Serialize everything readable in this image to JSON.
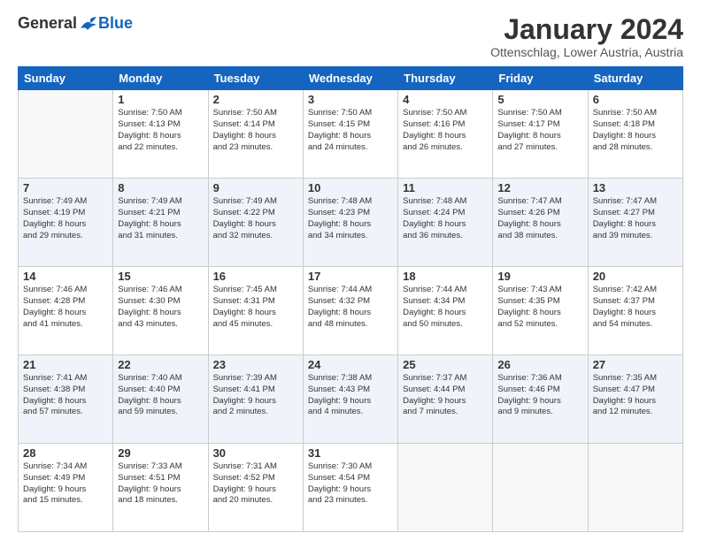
{
  "logo": {
    "general": "General",
    "blue": "Blue"
  },
  "header": {
    "title": "January 2024",
    "subtitle": "Ottenschlag, Lower Austria, Austria"
  },
  "days_of_week": [
    "Sunday",
    "Monday",
    "Tuesday",
    "Wednesday",
    "Thursday",
    "Friday",
    "Saturday"
  ],
  "weeks": [
    [
      {
        "day": "",
        "info": ""
      },
      {
        "day": "1",
        "info": "Sunrise: 7:50 AM\nSunset: 4:13 PM\nDaylight: 8 hours\nand 22 minutes."
      },
      {
        "day": "2",
        "info": "Sunrise: 7:50 AM\nSunset: 4:14 PM\nDaylight: 8 hours\nand 23 minutes."
      },
      {
        "day": "3",
        "info": "Sunrise: 7:50 AM\nSunset: 4:15 PM\nDaylight: 8 hours\nand 24 minutes."
      },
      {
        "day": "4",
        "info": "Sunrise: 7:50 AM\nSunset: 4:16 PM\nDaylight: 8 hours\nand 26 minutes."
      },
      {
        "day": "5",
        "info": "Sunrise: 7:50 AM\nSunset: 4:17 PM\nDaylight: 8 hours\nand 27 minutes."
      },
      {
        "day": "6",
        "info": "Sunrise: 7:50 AM\nSunset: 4:18 PM\nDaylight: 8 hours\nand 28 minutes."
      }
    ],
    [
      {
        "day": "7",
        "info": "Sunrise: 7:49 AM\nSunset: 4:19 PM\nDaylight: 8 hours\nand 29 minutes."
      },
      {
        "day": "8",
        "info": "Sunrise: 7:49 AM\nSunset: 4:21 PM\nDaylight: 8 hours\nand 31 minutes."
      },
      {
        "day": "9",
        "info": "Sunrise: 7:49 AM\nSunset: 4:22 PM\nDaylight: 8 hours\nand 32 minutes."
      },
      {
        "day": "10",
        "info": "Sunrise: 7:48 AM\nSunset: 4:23 PM\nDaylight: 8 hours\nand 34 minutes."
      },
      {
        "day": "11",
        "info": "Sunrise: 7:48 AM\nSunset: 4:24 PM\nDaylight: 8 hours\nand 36 minutes."
      },
      {
        "day": "12",
        "info": "Sunrise: 7:47 AM\nSunset: 4:26 PM\nDaylight: 8 hours\nand 38 minutes."
      },
      {
        "day": "13",
        "info": "Sunrise: 7:47 AM\nSunset: 4:27 PM\nDaylight: 8 hours\nand 39 minutes."
      }
    ],
    [
      {
        "day": "14",
        "info": "Sunrise: 7:46 AM\nSunset: 4:28 PM\nDaylight: 8 hours\nand 41 minutes."
      },
      {
        "day": "15",
        "info": "Sunrise: 7:46 AM\nSunset: 4:30 PM\nDaylight: 8 hours\nand 43 minutes."
      },
      {
        "day": "16",
        "info": "Sunrise: 7:45 AM\nSunset: 4:31 PM\nDaylight: 8 hours\nand 45 minutes."
      },
      {
        "day": "17",
        "info": "Sunrise: 7:44 AM\nSunset: 4:32 PM\nDaylight: 8 hours\nand 48 minutes."
      },
      {
        "day": "18",
        "info": "Sunrise: 7:44 AM\nSunset: 4:34 PM\nDaylight: 8 hours\nand 50 minutes."
      },
      {
        "day": "19",
        "info": "Sunrise: 7:43 AM\nSunset: 4:35 PM\nDaylight: 8 hours\nand 52 minutes."
      },
      {
        "day": "20",
        "info": "Sunrise: 7:42 AM\nSunset: 4:37 PM\nDaylight: 8 hours\nand 54 minutes."
      }
    ],
    [
      {
        "day": "21",
        "info": "Sunrise: 7:41 AM\nSunset: 4:38 PM\nDaylight: 8 hours\nand 57 minutes."
      },
      {
        "day": "22",
        "info": "Sunrise: 7:40 AM\nSunset: 4:40 PM\nDaylight: 8 hours\nand 59 minutes."
      },
      {
        "day": "23",
        "info": "Sunrise: 7:39 AM\nSunset: 4:41 PM\nDaylight: 9 hours\nand 2 minutes."
      },
      {
        "day": "24",
        "info": "Sunrise: 7:38 AM\nSunset: 4:43 PM\nDaylight: 9 hours\nand 4 minutes."
      },
      {
        "day": "25",
        "info": "Sunrise: 7:37 AM\nSunset: 4:44 PM\nDaylight: 9 hours\nand 7 minutes."
      },
      {
        "day": "26",
        "info": "Sunrise: 7:36 AM\nSunset: 4:46 PM\nDaylight: 9 hours\nand 9 minutes."
      },
      {
        "day": "27",
        "info": "Sunrise: 7:35 AM\nSunset: 4:47 PM\nDaylight: 9 hours\nand 12 minutes."
      }
    ],
    [
      {
        "day": "28",
        "info": "Sunrise: 7:34 AM\nSunset: 4:49 PM\nDaylight: 9 hours\nand 15 minutes."
      },
      {
        "day": "29",
        "info": "Sunrise: 7:33 AM\nSunset: 4:51 PM\nDaylight: 9 hours\nand 18 minutes."
      },
      {
        "day": "30",
        "info": "Sunrise: 7:31 AM\nSunset: 4:52 PM\nDaylight: 9 hours\nand 20 minutes."
      },
      {
        "day": "31",
        "info": "Sunrise: 7:30 AM\nSunset: 4:54 PM\nDaylight: 9 hours\nand 23 minutes."
      },
      {
        "day": "",
        "info": ""
      },
      {
        "day": "",
        "info": ""
      },
      {
        "day": "",
        "info": ""
      }
    ]
  ]
}
